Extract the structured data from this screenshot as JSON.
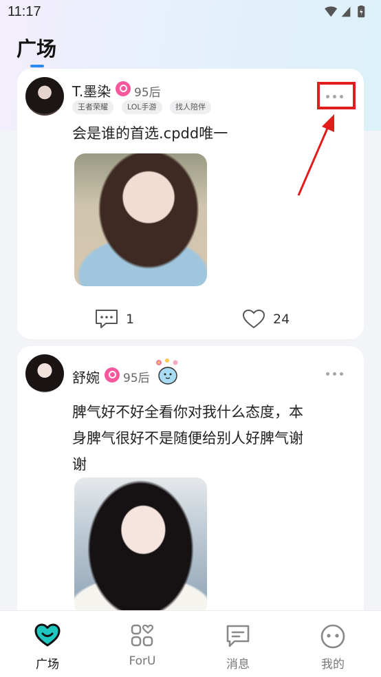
{
  "status_bar": {
    "time": "11:17"
  },
  "header": {
    "title": "广场"
  },
  "posts": [
    {
      "username": "T.墨染",
      "age": "95后",
      "tags": [
        "王者荣耀",
        "LOL手游",
        "找人陪伴"
      ],
      "text": [
        "会是谁的首选.cpdd唯一"
      ],
      "comments": "1",
      "likes": "24"
    },
    {
      "username": "舒婉",
      "age": "95后",
      "tags": [],
      "text": [
        "脾气好不好全看你对我什么态度，本",
        "身脾气很好不是随便给别人好脾气谢",
        "谢"
      ]
    }
  ],
  "tabbar": {
    "tabs": [
      {
        "label": "广场",
        "icon": "heart-chat-icon",
        "active": true
      },
      {
        "label": "ForU",
        "icon": "grid-heart-icon"
      },
      {
        "label": "消息",
        "icon": "message-icon"
      },
      {
        "label": "我的",
        "icon": "face-icon"
      }
    ]
  },
  "colors": {
    "accent": "#2a8cf2",
    "badge": "#f5589b",
    "highlight": "#e21b1b",
    "tab_active": "#1ec8c0"
  }
}
